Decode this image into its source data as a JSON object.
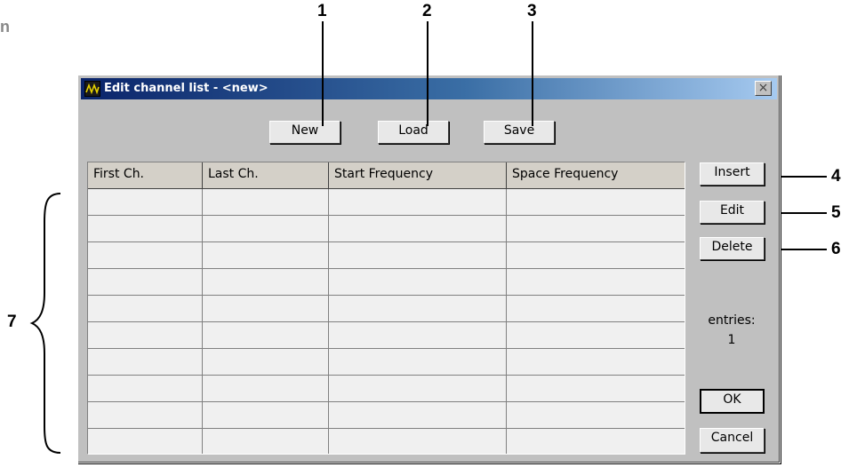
{
  "margin_letter": "n",
  "callouts": {
    "c1": "1",
    "c2": "2",
    "c3": "3",
    "c4": "4",
    "c5": "5",
    "c6": "6",
    "c7": "7"
  },
  "window": {
    "title": "Edit channel list - <new>",
    "close_glyph": "×"
  },
  "toolbar": {
    "new_label": "New",
    "load_label": "Load",
    "save_label": "Save"
  },
  "table": {
    "columns": [
      "First Ch.",
      "Last Ch.",
      "Start Frequency",
      "Space Frequency"
    ],
    "rows": [
      [
        "",
        "",
        "",
        ""
      ],
      [
        "",
        "",
        "",
        ""
      ],
      [
        "",
        "",
        "",
        ""
      ],
      [
        "",
        "",
        "",
        ""
      ],
      [
        "",
        "",
        "",
        ""
      ],
      [
        "",
        "",
        "",
        ""
      ],
      [
        "",
        "",
        "",
        ""
      ],
      [
        "",
        "",
        "",
        ""
      ],
      [
        "",
        "",
        "",
        ""
      ],
      [
        "",
        "",
        "",
        ""
      ]
    ]
  },
  "side": {
    "insert_label": "Insert",
    "edit_label": "Edit",
    "delete_label": "Delete",
    "entries_label": "entries:",
    "entries_count": "1",
    "ok_label": "OK",
    "cancel_label": "Cancel"
  },
  "colors": {
    "title_gradient_start": "#0a246a",
    "title_gradient_end": "#a6caf0",
    "face": "#c0c0c0",
    "table_bg": "#f0f0f0"
  },
  "icons": {
    "app": "oscilloscope-app-icon",
    "close": "close-icon"
  }
}
